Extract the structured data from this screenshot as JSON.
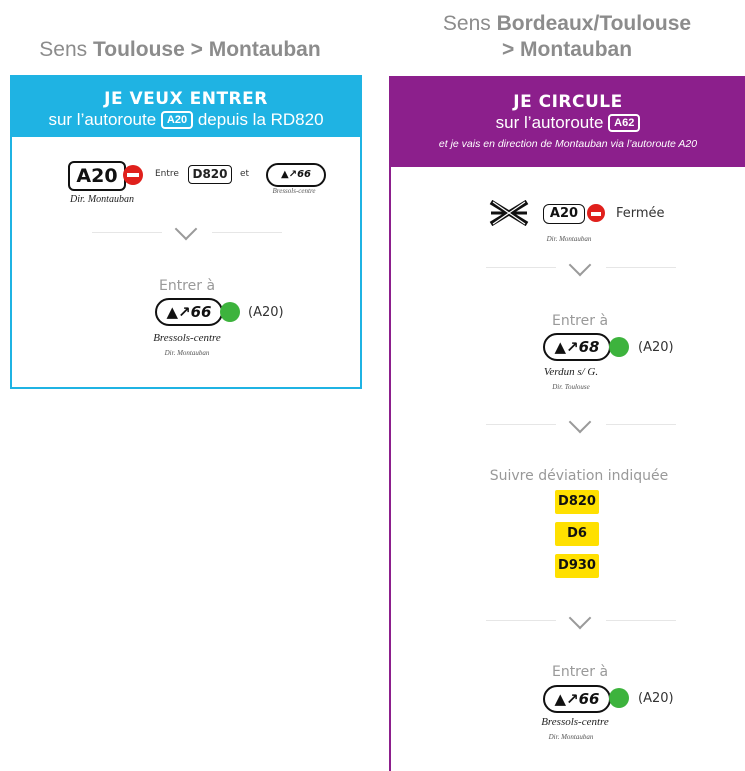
{
  "left": {
    "heading_prefix": "Sens",
    "heading_bold": "Toulouse > Montauban",
    "banner_title": "JE VEUX ENTRER",
    "banner_sub_before": "sur l’autoroute",
    "banner_sub_badge": "A20",
    "banner_sub_after": "depuis la RD820",
    "road": "A20",
    "road_dir": "Dir. Montauban",
    "entre": "Entre",
    "d820": "D820",
    "et": "et",
    "exit_small_num": "66",
    "exit_small_caption": "Bressols-centre",
    "entrer_label": "Entrer à",
    "exit_num": "66",
    "exit_road": "(A20)",
    "exit_name": "Bressols-centre",
    "exit_dir": "Dir. Montauban"
  },
  "right": {
    "heading_prefix": "Sens",
    "heading_bold_1": "Bordeaux/Toulouse",
    "heading_bold_2": "> Montauban",
    "banner_title": "JE CIRCULE",
    "banner_sub_before": "sur l’autoroute",
    "banner_sub_badge": "A62",
    "banner_note": "et je vais en direction de Montauban via l’autoroute A20",
    "closed_road": "A20",
    "closed_label": "Fermée",
    "closed_dir": "Dir. Montauban",
    "entrer1_label": "Entrer à",
    "exit1_num": "68",
    "exit1_road": "(A20)",
    "exit1_name": "Verdun s/ G.",
    "exit1_dir": "Dir. Toulouse",
    "detour_label": "Suivre déviation indiquée",
    "detour_roads": [
      "D820",
      "D6",
      "D930"
    ],
    "entrer2_label": "Entrer à",
    "exit2_num": "66",
    "exit2_road": "(A20)",
    "exit2_name": "Bressols-centre",
    "exit2_dir": "Dir. Montauban"
  },
  "colors": {
    "left_accent": "#1fb3e3",
    "right_accent": "#8c1f8c",
    "no_entry_red": "#e0201c",
    "open_green": "#3db33d",
    "detour_yellow": "#ffe000"
  },
  "icons": [
    "no-entry-icon",
    "motorway-exit-icon",
    "interchange-closed-icon",
    "chevron-down-icon",
    "open-status-icon"
  ]
}
